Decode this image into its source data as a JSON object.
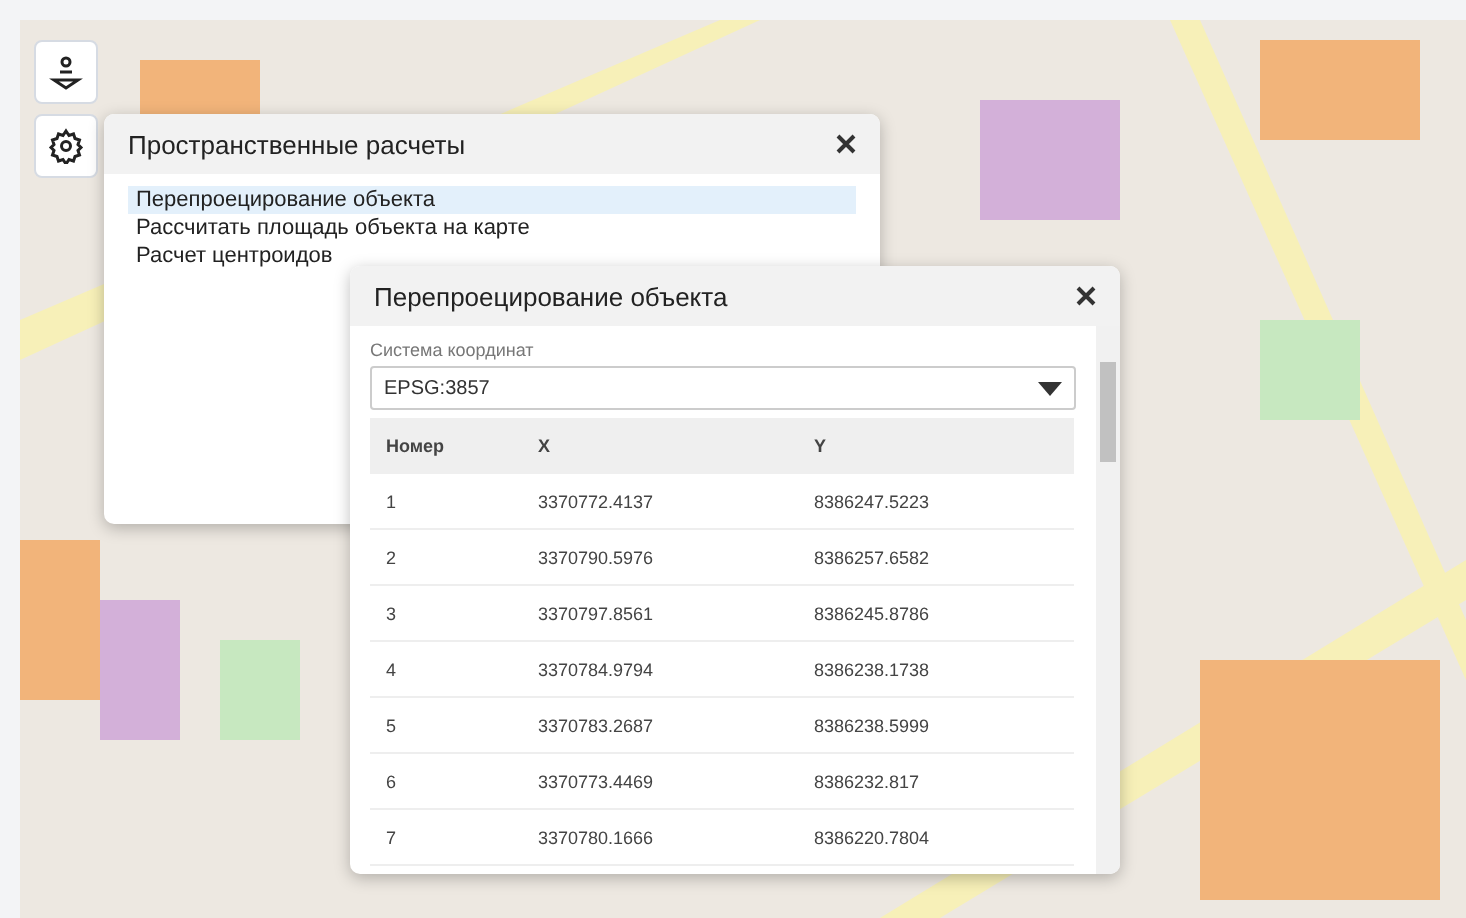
{
  "tools_panel": {
    "title": "Пространственные расчеты",
    "items": [
      {
        "label": "Перепроецирование объекта",
        "selected": true
      },
      {
        "label": "Рассчитать площадь объекта на карте",
        "selected": false
      },
      {
        "label": "Расчет центроидов",
        "selected": false
      }
    ]
  },
  "reproject_dialog": {
    "title": "Перепроецирование объекта",
    "crs_label": "Система координат",
    "crs_value": "EPSG:3857",
    "columns": [
      "Номер",
      "X",
      "Y"
    ],
    "rows": [
      [
        "1",
        "3370772.4137",
        "8386247.5223"
      ],
      [
        "2",
        "3370790.5976",
        "8386257.6582"
      ],
      [
        "3",
        "3370797.8561",
        "8386245.8786"
      ],
      [
        "4",
        "3370784.9794",
        "8386238.1738"
      ],
      [
        "5",
        "3370783.2687",
        "8386238.5999"
      ],
      [
        "6",
        "3370773.4469",
        "8386232.817"
      ],
      [
        "7",
        "3370780.1666",
        "8386220.7804"
      ]
    ]
  }
}
